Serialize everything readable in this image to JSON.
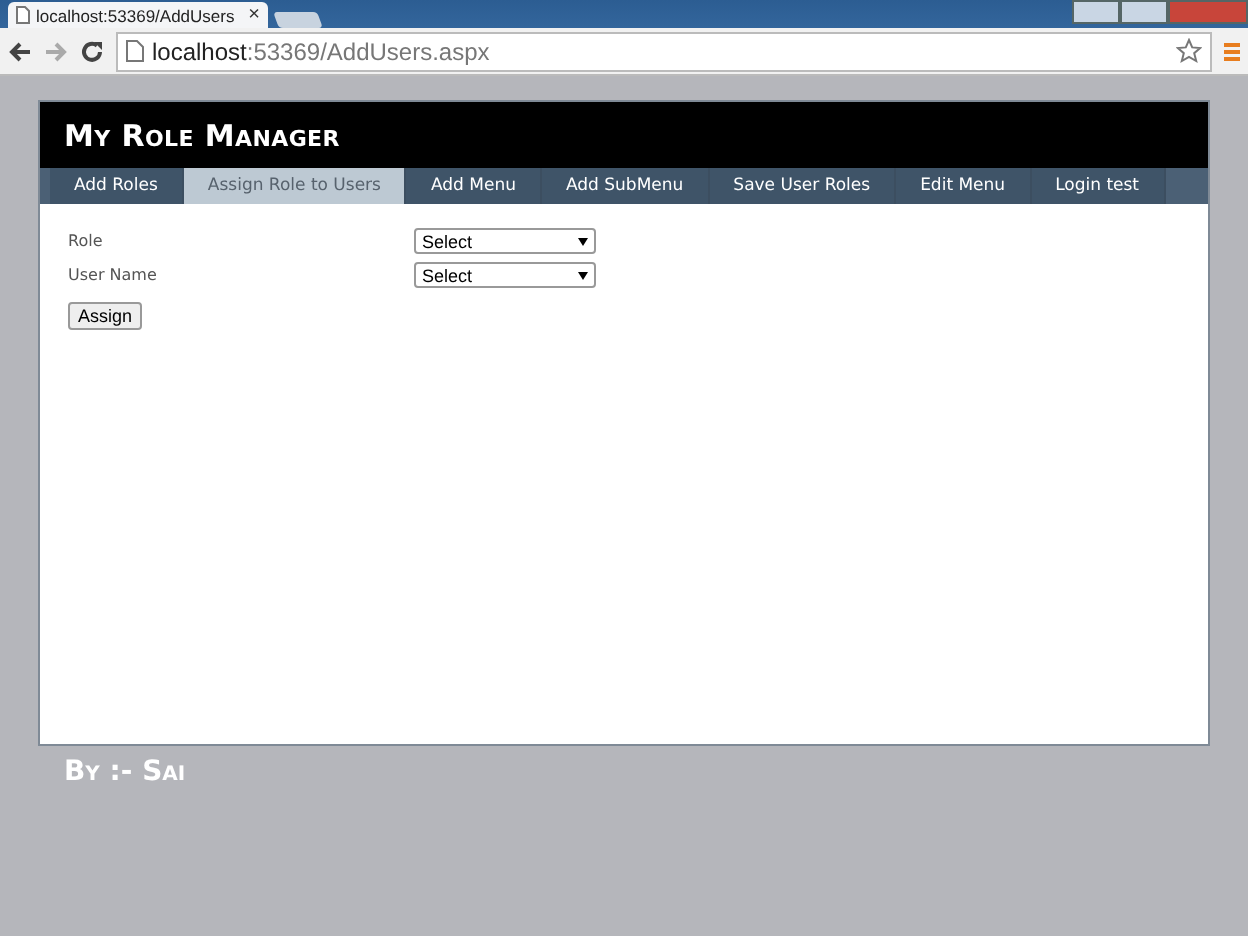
{
  "browser": {
    "tab_title": "localhost:53369/AddUsers",
    "tab_close": "×",
    "url_host": "localhost",
    "url_rest": ":53369/AddUsers.aspx"
  },
  "site_title": "My Role Manager",
  "nav": [
    {
      "label": "Add Roles",
      "selected": false
    },
    {
      "label": "Assign Role to Users",
      "selected": true
    },
    {
      "label": "Add Menu",
      "selected": false
    },
    {
      "label": "Add SubMenu",
      "selected": false
    },
    {
      "label": "Save User Roles",
      "selected": false
    },
    {
      "label": "Edit Menu",
      "selected": false
    },
    {
      "label": "Login test",
      "selected": false
    }
  ],
  "form": [
    {
      "label": "Role",
      "value": "Select"
    },
    {
      "label": "User Name",
      "value": "Select"
    }
  ],
  "submit": "Assign",
  "footer": "By :- Sai"
}
